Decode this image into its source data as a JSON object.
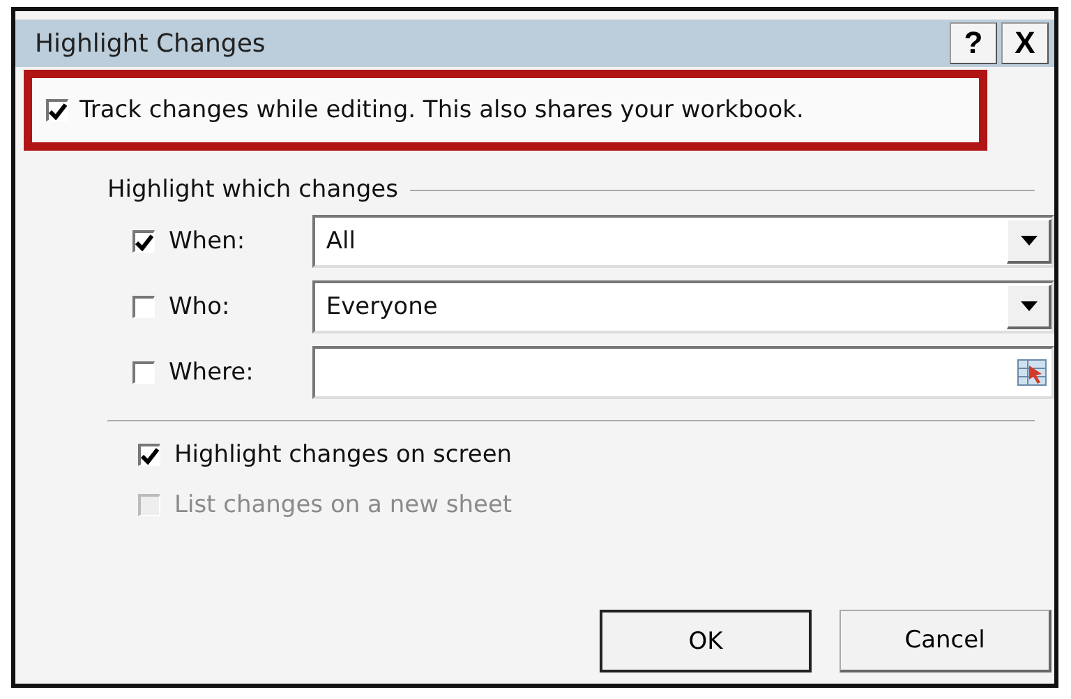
{
  "window": {
    "title": "Highlight Changes",
    "help": "?",
    "close": "X"
  },
  "track_changes": {
    "label": "Track changes while editing. This also shares your workbook.",
    "checked": true,
    "highlighted": true
  },
  "group": {
    "title": "Highlight which changes",
    "filters": [
      {
        "label": "When:",
        "checked": true,
        "kind": "dropdown",
        "value": "All"
      },
      {
        "label": "Who:",
        "checked": false,
        "kind": "dropdown",
        "value": "Everyone"
      },
      {
        "label": "Where:",
        "checked": false,
        "kind": "range"
      }
    ]
  },
  "options": [
    {
      "label": "Highlight changes on screen",
      "checked": true,
      "disabled": false
    },
    {
      "label": "List changes on a new sheet",
      "checked": false,
      "disabled": true
    }
  ],
  "buttons": [
    "OK",
    "Cancel"
  ]
}
